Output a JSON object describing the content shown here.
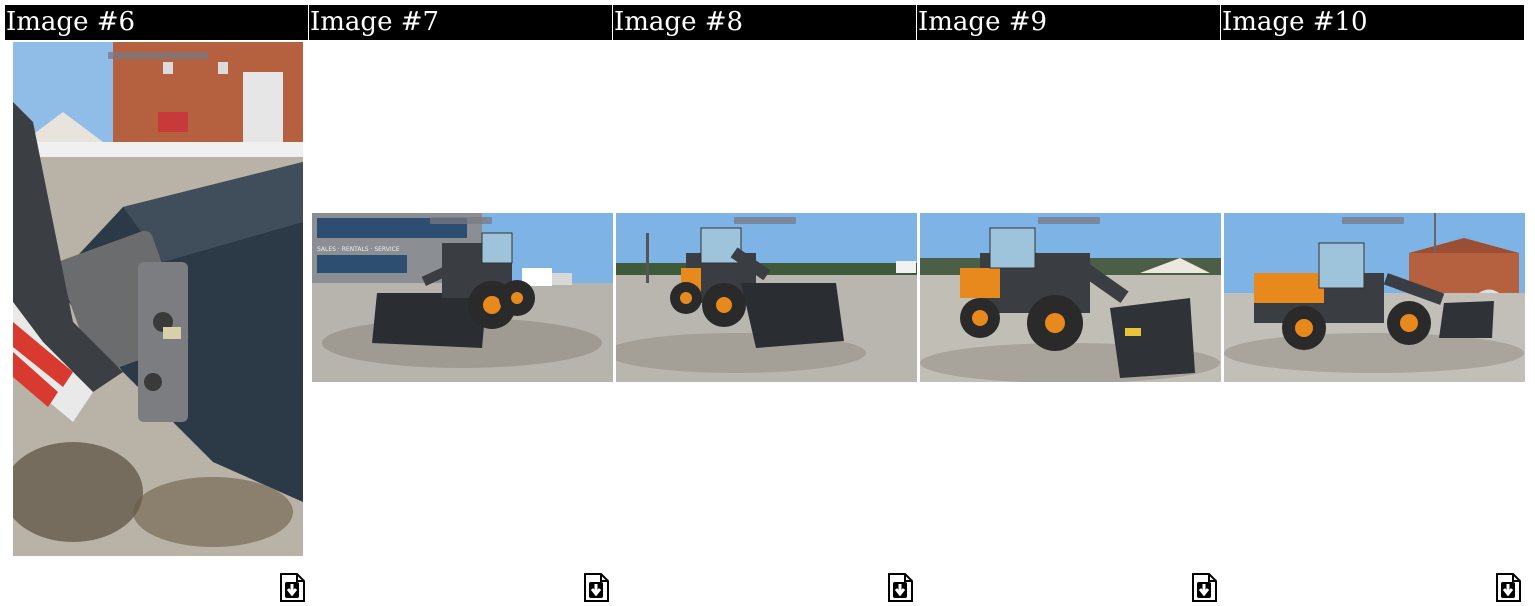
{
  "gallery": {
    "items": [
      {
        "label": "Image #6",
        "subject": "loader bucket coupler close-up",
        "download_icon": "download-icon"
      },
      {
        "label": "Image #7",
        "subject": "wheel loader front view with building",
        "download_icon": "download-icon"
      },
      {
        "label": "Image #8",
        "subject": "wheel loader front quarter view",
        "download_icon": "download-icon"
      },
      {
        "label": "Image #9",
        "subject": "wheel loader side quarter view",
        "download_icon": "download-icon"
      },
      {
        "label": "Image #10",
        "subject": "wheel loader side profile with barn",
        "download_icon": "download-icon"
      }
    ],
    "building_sign": "SALES · RENTALS · SERVICE",
    "colors": {
      "header_bg": "#000000",
      "header_text": "#ffffff",
      "loader_orange": "#e8891e",
      "loader_body": "#3a3d42",
      "sky": "#7eb3e6"
    }
  }
}
